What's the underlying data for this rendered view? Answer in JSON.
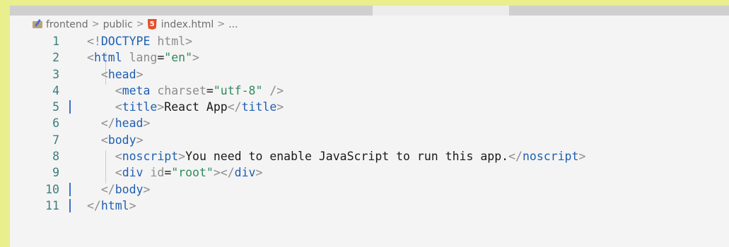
{
  "breadcrumb": {
    "folder": "frontend",
    "subfolder": "public",
    "file": "index.html",
    "ellipsis": "...",
    "separator": ">",
    "html_icon": "5"
  },
  "lines": [
    {
      "n": "1",
      "modified": false,
      "tokens": [
        [
          "punct",
          "<!"
        ],
        [
          "kw",
          "DOCTYPE"
        ],
        [
          "punct",
          " html>"
        ]
      ]
    },
    {
      "n": "2",
      "modified": false,
      "tokens": [
        [
          "punct",
          "<"
        ],
        [
          "kw",
          "html"
        ],
        [
          "attr",
          " lang"
        ],
        [
          "txt",
          "="
        ],
        [
          "str",
          "\"en\""
        ],
        [
          "punct",
          ">"
        ]
      ]
    },
    {
      "n": "3",
      "modified": false,
      "tokens": [
        [
          "txt",
          "  "
        ],
        [
          "punct",
          "<"
        ],
        [
          "kw",
          "head"
        ],
        [
          "punct",
          ">"
        ]
      ]
    },
    {
      "n": "4",
      "modified": false,
      "tokens": [
        [
          "txt",
          "    "
        ],
        [
          "punct",
          "<"
        ],
        [
          "kw",
          "meta"
        ],
        [
          "attr",
          " charset"
        ],
        [
          "txt",
          "="
        ],
        [
          "str",
          "\"utf-8\""
        ],
        [
          "punct",
          " />"
        ]
      ]
    },
    {
      "n": "5",
      "modified": true,
      "tokens": [
        [
          "txt",
          "    "
        ],
        [
          "punct",
          "<"
        ],
        [
          "kw",
          "title"
        ],
        [
          "punct",
          ">"
        ],
        [
          "txt",
          "React App"
        ],
        [
          "punct",
          "</"
        ],
        [
          "kw",
          "title"
        ],
        [
          "punct",
          ">"
        ]
      ]
    },
    {
      "n": "6",
      "modified": false,
      "tokens": [
        [
          "txt",
          "  "
        ],
        [
          "punct",
          "</"
        ],
        [
          "kw",
          "head"
        ],
        [
          "punct",
          ">"
        ]
      ]
    },
    {
      "n": "7",
      "modified": false,
      "tokens": [
        [
          "txt",
          "  "
        ],
        [
          "punct",
          "<"
        ],
        [
          "kw",
          "body"
        ],
        [
          "punct",
          ">"
        ]
      ]
    },
    {
      "n": "8",
      "modified": false,
      "tokens": [
        [
          "txt",
          "    "
        ],
        [
          "punct",
          "<"
        ],
        [
          "kw",
          "noscript"
        ],
        [
          "punct",
          ">"
        ],
        [
          "txt",
          "You need to enable JavaScript to run this app."
        ],
        [
          "punct",
          "</"
        ],
        [
          "kw",
          "noscript"
        ],
        [
          "punct",
          ">"
        ]
      ]
    },
    {
      "n": "9",
      "modified": false,
      "tokens": [
        [
          "txt",
          "    "
        ],
        [
          "punct",
          "<"
        ],
        [
          "kw",
          "div"
        ],
        [
          "attr",
          " id"
        ],
        [
          "txt",
          "="
        ],
        [
          "str",
          "\"root\""
        ],
        [
          "punct",
          "></"
        ],
        [
          "kw",
          "div"
        ],
        [
          "punct",
          ">"
        ]
      ]
    },
    {
      "n": "10",
      "modified": true,
      "tokens": [
        [
          "txt",
          "  "
        ],
        [
          "punct",
          "</"
        ],
        [
          "kw",
          "body"
        ],
        [
          "punct",
          ">"
        ]
      ]
    },
    {
      "n": "11",
      "modified": true,
      "tokens": [
        [
          "punct",
          "</"
        ],
        [
          "kw",
          "html"
        ],
        [
          "punct",
          ">"
        ]
      ]
    }
  ]
}
